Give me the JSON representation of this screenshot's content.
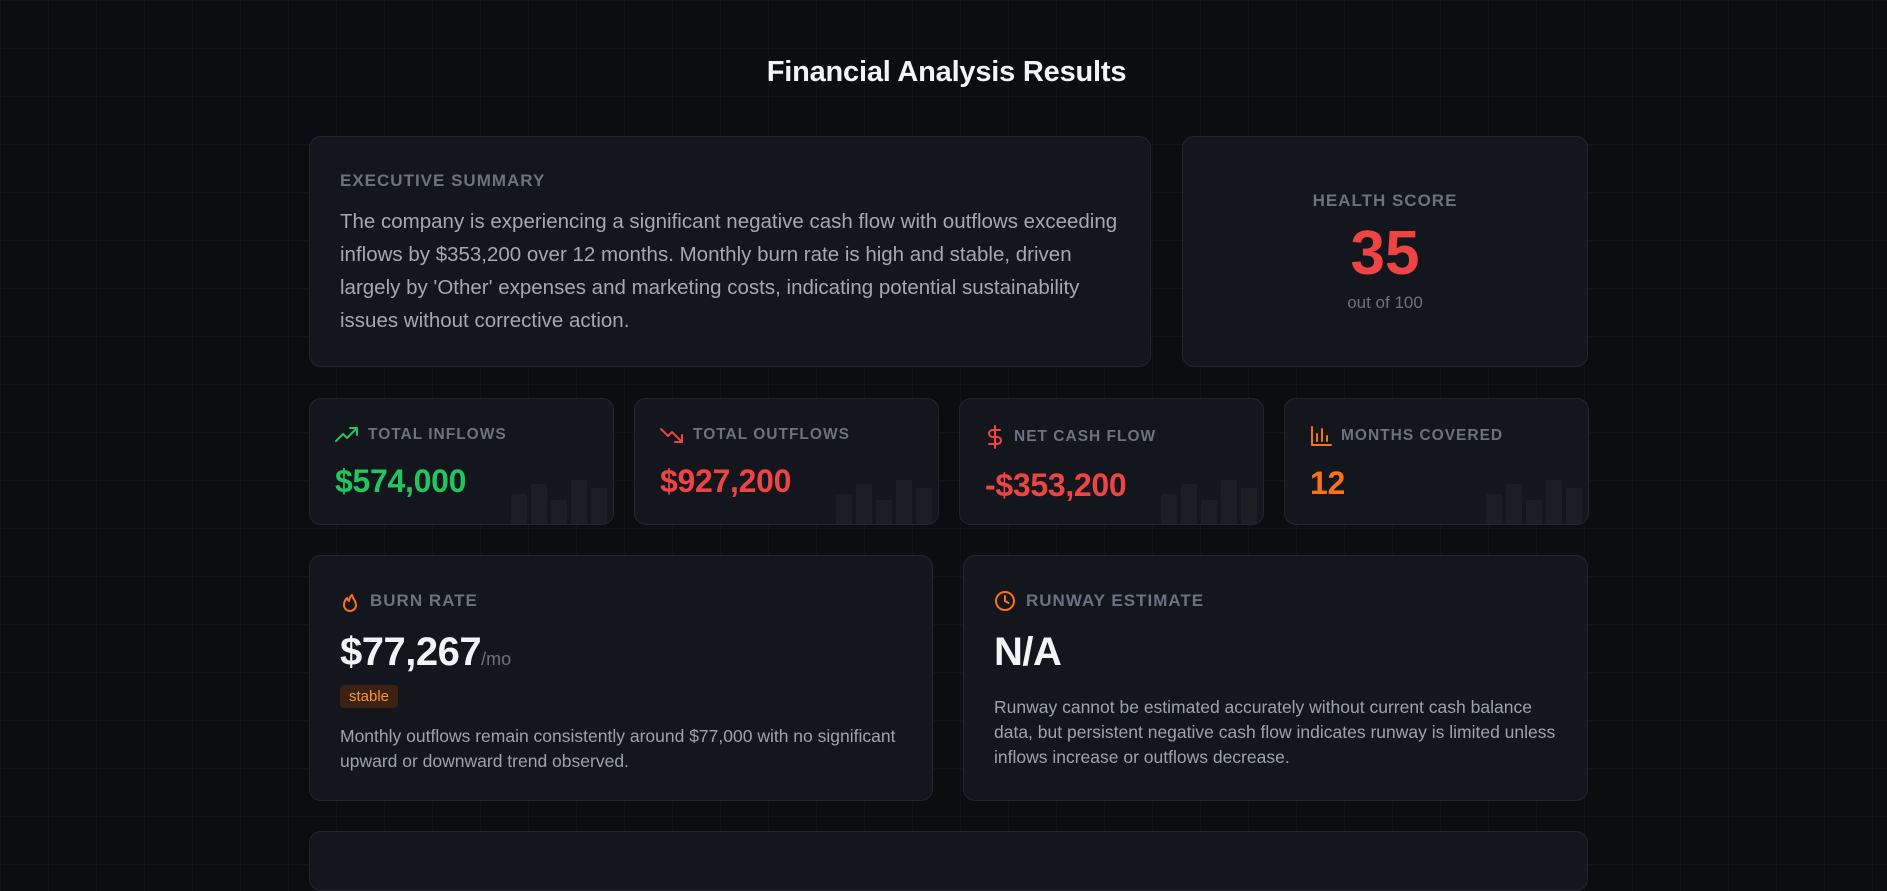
{
  "page": {
    "title": "Financial Analysis Results"
  },
  "summary": {
    "label": "EXECUTIVE SUMMARY",
    "text": "The company is experiencing a significant negative cash flow with outflows exceeding inflows by $353,200 over 12 months. Monthly burn rate is high and stable, driven largely by 'Other' expenses and marketing costs, indicating potential sustainability issues without corrective action."
  },
  "health": {
    "label": "HEALTH SCORE",
    "score": "35",
    "sub": "out of 100",
    "color": "#ef4444"
  },
  "stats": [
    {
      "label": "TOTAL INFLOWS",
      "value": "$574,000",
      "icon": "trending-up-icon",
      "color": "#22c55e"
    },
    {
      "label": "TOTAL OUTFLOWS",
      "value": "$927,200",
      "icon": "trending-down-icon",
      "color": "#ef4444"
    },
    {
      "label": "NET CASH FLOW",
      "value": "-$353,200",
      "icon": "dollar-icon",
      "color": "#ef4444"
    },
    {
      "label": "MONTHS COVERED",
      "value": "12",
      "icon": "bar-chart-icon",
      "color": "#f97316"
    }
  ],
  "burn": {
    "label": "BURN RATE",
    "value": "$77,267",
    "unit": "/mo",
    "badge": "stable",
    "icon": "flame-icon",
    "desc": "Monthly outflows remain consistently around $77,000 with no significant upward or downward trend observed."
  },
  "runway": {
    "label": "RUNWAY ESTIMATE",
    "value": "N/A",
    "icon": "clock-icon",
    "desc": "Runway cannot be estimated accurately without current cash balance data, but persistent negative cash flow indicates runway is limited unless inflows increase or outflows decrease."
  },
  "colors": {
    "accent_positive": "#22c55e",
    "accent_negative": "#ef4444",
    "accent_warning": "#f97316",
    "background": "#0c0d11",
    "card": "#14161d"
  }
}
